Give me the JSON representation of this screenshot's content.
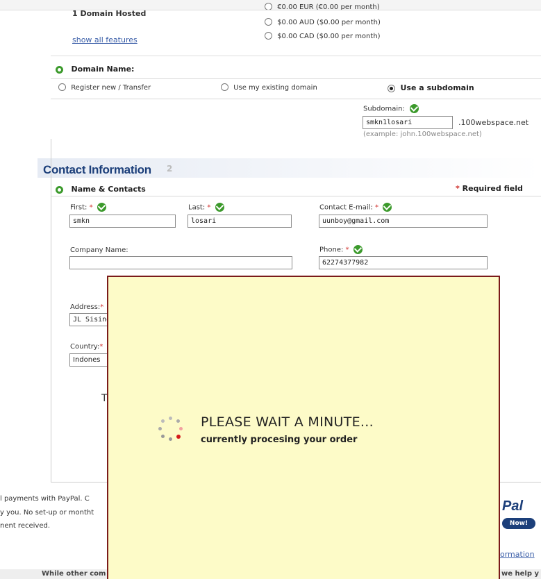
{
  "plan": {
    "hosted_label": "1 Domain Hosted",
    "show_features_link": "show all features",
    "currency_cut": "€0.00 EUR (€0.00 per month)",
    "currency_aud": "$0.00 AUD ($0.00 per month)",
    "currency_cad": "$0.00 CAD ($0.00 per month)"
  },
  "domain": {
    "heading": "Domain Name:",
    "opt_register": "Register new / Transfer",
    "opt_existing": "Use my existing domain",
    "opt_subdomain": "Use a subdomain",
    "subdomain_label": "Subdomain:",
    "subdomain_value": "smkn1losari",
    "subdomain_suffix": ".100webspace.net",
    "subdomain_example": "(example: john.100webspace.net)"
  },
  "contact": {
    "section_title": "Contact Information",
    "section_step": "2",
    "subheading": "Name & Contacts",
    "required_note": "Required field",
    "first_label": "First:",
    "first_value": "smkn",
    "last_label": "Last:",
    "last_value": "losari",
    "email_label": "Contact E-mail:",
    "email_value": "uunboy@gmail.com",
    "company_label": "Company Name:",
    "company_value": "",
    "phone_label": "Phone:",
    "phone_value": "62274377982",
    "address_label": "Address:",
    "address_value": "JL Sisinga",
    "country_label": "Country:",
    "country_value": "Indones",
    "partial_text": "T"
  },
  "footer": {
    "paypal_line1": "l payments with PayPal. C",
    "paypal_line2": "y you. No set-up or montht",
    "paypal_line3": "nent received.",
    "paypal_logo": "Pal",
    "paypal_now": "Now!",
    "more_info": "ormation",
    "bottom_left": "While other com",
    "bottom_right": "we help y"
  },
  "overlay": {
    "title": "PLEASE WAIT A MINUTE...",
    "subtitle": "currently procesing your order"
  },
  "colors": {
    "accent_green": "#3c9a2c",
    "section_blue": "#1c3f7a",
    "overlay_bg": "#fdfbc8",
    "overlay_border": "#7a1a1a",
    "required_red": "#d0312d"
  }
}
